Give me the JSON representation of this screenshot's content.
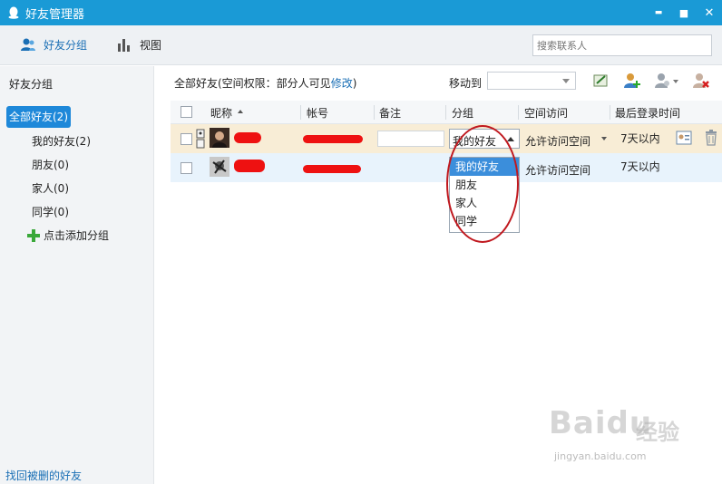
{
  "window": {
    "title": "好友管理器",
    "minimize": "▬",
    "maximize": "■",
    "close": "✕"
  },
  "toolbar": {
    "friend_groups": "好友分组",
    "view": "视图",
    "search_placeholder": "搜索联系人"
  },
  "sidebar": {
    "header": "好友分组",
    "all_friends": "全部好友(2)",
    "groups": [
      "我的好友(2)",
      "朋友(0)",
      "家人(0)",
      "同学(0)"
    ],
    "add_group": "点击添加分组",
    "recover_deleted": "找回被删的好友"
  },
  "main": {
    "privacy_text": "全部好友(空间权限：部分人可见",
    "privacy_link": "修改",
    "privacy_close": ")",
    "move_to": "移动到",
    "columns": {
      "nickname": "昵称",
      "account": "帐号",
      "remark": "备注",
      "group": "分组",
      "space_access": "空间访问",
      "last_login": "最后登录时间"
    },
    "rows": [
      {
        "group": "我的好友",
        "space_access": "允许访问空间",
        "last_login": "7天以内"
      },
      {
        "space_access": "允许访问空间",
        "last_login": "7天以内"
      }
    ],
    "group_options": [
      "我的好友",
      "朋友",
      "家人",
      "同学"
    ],
    "group_selected": "我的好友"
  },
  "watermark": {
    "brand": "Baidu",
    "cn": "经验",
    "url": "jingyan.baidu.com"
  },
  "colors": {
    "titlebar": "#1a9ad6",
    "accent": "#1e88d9",
    "link": "#1a6fb5",
    "selected_row": "#f8edd6",
    "hover_row": "#e8f3fc",
    "annotation": "#c0181e"
  }
}
